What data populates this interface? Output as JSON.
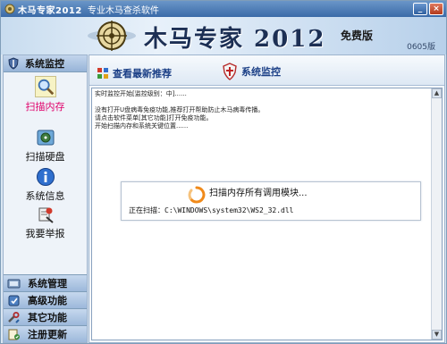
{
  "window": {
    "title": "木马专家2012",
    "subtitle": "专业木马查杀软件",
    "controls": [
      "minimize",
      "close"
    ]
  },
  "banner": {
    "product_name": "木马专家 2012",
    "edition": "免费版",
    "version": "0605版"
  },
  "sidebar": {
    "header": "系统监控",
    "header_icon": "shield-icon",
    "items": [
      {
        "label": "扫描内存",
        "icon": "magnifier-icon",
        "active": true
      },
      {
        "label": "扫描硬盘",
        "icon": "disk-icon",
        "active": false
      },
      {
        "label": "系统信息",
        "icon": "info-icon",
        "active": false
      },
      {
        "label": "我要举报",
        "icon": "report-icon",
        "active": false
      }
    ],
    "footer": [
      {
        "label": "系统管理",
        "icon": "system-manage-icon"
      },
      {
        "label": "高级功能",
        "icon": "advanced-icon"
      },
      {
        "label": "其它功能",
        "icon": "tools-icon"
      },
      {
        "label": "注册更新",
        "icon": "register-icon"
      }
    ]
  },
  "toolbar": {
    "recommend_label": "查看最新推荐",
    "monitor_label": "系统监控"
  },
  "log": {
    "lines": [
      "实时监控开始[监控级别：中]......",
      "",
      "没有打开U盘病毒免疫功能,推荐打开帮助防止木马病毒传播。",
      "请点击软件菜单[其它功能]打开免疫功能。",
      "开始扫描内存和系统关键位置......"
    ]
  },
  "progress": {
    "message": "扫描内存所有调用模块...",
    "scan_label": "正在扫描：",
    "scan_path": "C:\\WINDOWS\\system32\\WS2_32.dll"
  },
  "colors": {
    "accent": "#1b3f86",
    "active_item": "#e0006a",
    "titlebar": "#3a6aa8"
  }
}
